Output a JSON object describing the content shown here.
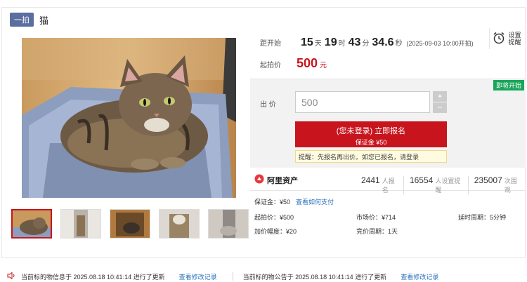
{
  "header": {
    "badge": "一拍",
    "title": "猫"
  },
  "countdown": {
    "label": "距开始",
    "days": "15",
    "days_unit": "天",
    "hours": "19",
    "hours_unit": "时",
    "minutes": "43",
    "minutes_unit": "分",
    "seconds": "34.6",
    "seconds_unit": "秒",
    "start_time": "(2025-09-03 10:00开拍)"
  },
  "reminder": {
    "label": "设置提醒"
  },
  "start_price": {
    "label": "起拍价",
    "value": "500",
    "unit": "元"
  },
  "bid": {
    "status_tag": "即将开始",
    "label": "出 价",
    "input_value": "500",
    "plus": "+",
    "minus": "−",
    "apply_main": "(您未登录) 立即报名",
    "apply_sub": "保证金 ¥50",
    "notice": "提醒：先报名再出价。如您已报名，请登录"
  },
  "org": {
    "name": "阿里资产",
    "stats": [
      {
        "num": "2441",
        "label": "人报名"
      },
      {
        "num": "16554",
        "label": "人设置提醒"
      },
      {
        "num": "235007",
        "label": "次围观"
      }
    ]
  },
  "details": {
    "deposit_label": "保证金：¥50",
    "deposit_link": "查看如何支付",
    "start_price": "起拍价：¥500",
    "market_price": "市场价：¥714",
    "delay_period": "延时周期：5分钟",
    "increment": "加价幅度：¥20",
    "bid_period": "竞价周期：1天"
  },
  "footer": {
    "info_update": "当前标的物信息于 2025.08.18 10:41:14 进行了更新",
    "info_link": "查看修改记录",
    "notice_update": "当前标的物公告于 2025.08.18 10:41:14 进行了更新",
    "notice_link": "查看修改记录"
  },
  "colors": {
    "accent": "#c8151d",
    "link": "#2a6fbd",
    "live": "#1aa55a",
    "badge": "#5b6ea0"
  },
  "icons": [
    "alarm-clock-icon",
    "alibaba-asset-logo-icon",
    "speaker-icon"
  ]
}
